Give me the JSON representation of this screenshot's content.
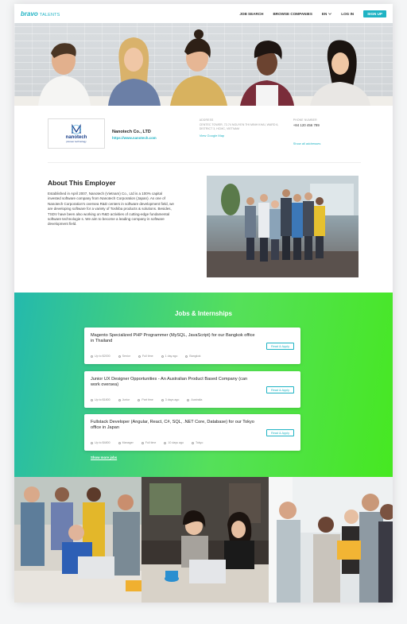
{
  "header": {
    "logo_brand": "bravo",
    "logo_sub": "TALENTS",
    "nav": {
      "job_search": "JOB SEARCH",
      "browse": "BROWSE COMPANIES",
      "lang": "EN",
      "login": "LOG IN",
      "signup": "SIGN UP"
    }
  },
  "company": {
    "logo_word": "nanotech",
    "logo_tag": "pioneer technology",
    "name": "Nanotech Co., LTD",
    "website": "https://www.nanotech.com",
    "address_label": "ADDRESS",
    "address_value": "CENTEC TOWER, 72-74 NGUYEN THI MINH KHAI, WARD 6, DISTRICT 3, HCMC, VIETNAM",
    "map_link": "View Google Map",
    "phone_label": "PHONE NUMBER",
    "phone_value": "+84 120 456 789",
    "all_addresses": "Show all addresses"
  },
  "about": {
    "title": "About This Employer",
    "body": "Established in April 2007, Nanotech (Vietnam) Co., Ltd is a 100% capital invested software company from Nanotech Corporation (Japan). As one of Nanotech Corporation's oversea R&D centers in software development field, we are developing software for a variety of Toshiba products & solutions. Besides, TSDV have been also working on R&D activities of cutting-edge fundamental software technologie s. We aim to become a leading company in software development field."
  },
  "jobs": {
    "title": "Jobs & Internships",
    "apply_label": "Read & Apply",
    "show_more": "Show more jobs",
    "items": [
      {
        "title": "Magento Specialized PHP Programmer (MySQL, JavaScript) for our Bangkok office in Thailand",
        "salary": "Up to $2000",
        "level": "Senior",
        "type": "Full time",
        "posted": "1 day ago",
        "location": "Bangkok"
      },
      {
        "title": "Junior UX Designer Opportunities - An Australian Product Based Company (can work oversea)",
        "salary": "Up to $1800",
        "level": "Junior",
        "type": "Part time",
        "posted": "3 days ago",
        "location": "Australia"
      },
      {
        "title": "Fullstack Developer (Angular, React, C#, SQL, .NET Core, Database) for our Tokyo office in Japan",
        "salary": "Up to $4800",
        "level": "Manager",
        "type": "Full time",
        "posted": "10 days ago",
        "location": "Tokyo"
      }
    ]
  },
  "colors": {
    "accent": "#1fb3c4",
    "gradient_start": "#24b9ad",
    "gradient_end": "#46e821"
  }
}
